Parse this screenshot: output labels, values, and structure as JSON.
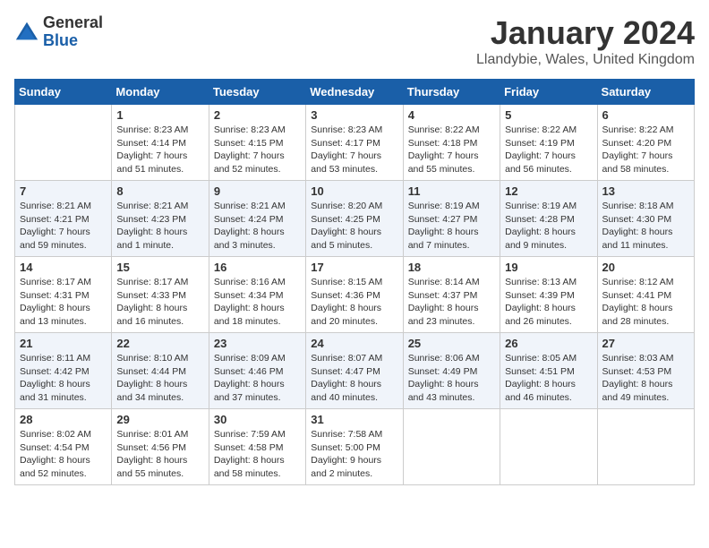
{
  "header": {
    "logo_line1": "General",
    "logo_line2": "Blue",
    "month_title": "January 2024",
    "location": "Llandybie, Wales, United Kingdom"
  },
  "weekdays": [
    "Sunday",
    "Monday",
    "Tuesday",
    "Wednesday",
    "Thursday",
    "Friday",
    "Saturday"
  ],
  "weeks": [
    [
      {
        "day": "",
        "sunrise": "",
        "sunset": "",
        "daylight": ""
      },
      {
        "day": "1",
        "sunrise": "Sunrise: 8:23 AM",
        "sunset": "Sunset: 4:14 PM",
        "daylight": "Daylight: 7 hours and 51 minutes."
      },
      {
        "day": "2",
        "sunrise": "Sunrise: 8:23 AM",
        "sunset": "Sunset: 4:15 PM",
        "daylight": "Daylight: 7 hours and 52 minutes."
      },
      {
        "day": "3",
        "sunrise": "Sunrise: 8:23 AM",
        "sunset": "Sunset: 4:17 PM",
        "daylight": "Daylight: 7 hours and 53 minutes."
      },
      {
        "day": "4",
        "sunrise": "Sunrise: 8:22 AM",
        "sunset": "Sunset: 4:18 PM",
        "daylight": "Daylight: 7 hours and 55 minutes."
      },
      {
        "day": "5",
        "sunrise": "Sunrise: 8:22 AM",
        "sunset": "Sunset: 4:19 PM",
        "daylight": "Daylight: 7 hours and 56 minutes."
      },
      {
        "day": "6",
        "sunrise": "Sunrise: 8:22 AM",
        "sunset": "Sunset: 4:20 PM",
        "daylight": "Daylight: 7 hours and 58 minutes."
      }
    ],
    [
      {
        "day": "7",
        "sunrise": "Sunrise: 8:21 AM",
        "sunset": "Sunset: 4:21 PM",
        "daylight": "Daylight: 7 hours and 59 minutes."
      },
      {
        "day": "8",
        "sunrise": "Sunrise: 8:21 AM",
        "sunset": "Sunset: 4:23 PM",
        "daylight": "Daylight: 8 hours and 1 minute."
      },
      {
        "day": "9",
        "sunrise": "Sunrise: 8:21 AM",
        "sunset": "Sunset: 4:24 PM",
        "daylight": "Daylight: 8 hours and 3 minutes."
      },
      {
        "day": "10",
        "sunrise": "Sunrise: 8:20 AM",
        "sunset": "Sunset: 4:25 PM",
        "daylight": "Daylight: 8 hours and 5 minutes."
      },
      {
        "day": "11",
        "sunrise": "Sunrise: 8:19 AM",
        "sunset": "Sunset: 4:27 PM",
        "daylight": "Daylight: 8 hours and 7 minutes."
      },
      {
        "day": "12",
        "sunrise": "Sunrise: 8:19 AM",
        "sunset": "Sunset: 4:28 PM",
        "daylight": "Daylight: 8 hours and 9 minutes."
      },
      {
        "day": "13",
        "sunrise": "Sunrise: 8:18 AM",
        "sunset": "Sunset: 4:30 PM",
        "daylight": "Daylight: 8 hours and 11 minutes."
      }
    ],
    [
      {
        "day": "14",
        "sunrise": "Sunrise: 8:17 AM",
        "sunset": "Sunset: 4:31 PM",
        "daylight": "Daylight: 8 hours and 13 minutes."
      },
      {
        "day": "15",
        "sunrise": "Sunrise: 8:17 AM",
        "sunset": "Sunset: 4:33 PM",
        "daylight": "Daylight: 8 hours and 16 minutes."
      },
      {
        "day": "16",
        "sunrise": "Sunrise: 8:16 AM",
        "sunset": "Sunset: 4:34 PM",
        "daylight": "Daylight: 8 hours and 18 minutes."
      },
      {
        "day": "17",
        "sunrise": "Sunrise: 8:15 AM",
        "sunset": "Sunset: 4:36 PM",
        "daylight": "Daylight: 8 hours and 20 minutes."
      },
      {
        "day": "18",
        "sunrise": "Sunrise: 8:14 AM",
        "sunset": "Sunset: 4:37 PM",
        "daylight": "Daylight: 8 hours and 23 minutes."
      },
      {
        "day": "19",
        "sunrise": "Sunrise: 8:13 AM",
        "sunset": "Sunset: 4:39 PM",
        "daylight": "Daylight: 8 hours and 26 minutes."
      },
      {
        "day": "20",
        "sunrise": "Sunrise: 8:12 AM",
        "sunset": "Sunset: 4:41 PM",
        "daylight": "Daylight: 8 hours and 28 minutes."
      }
    ],
    [
      {
        "day": "21",
        "sunrise": "Sunrise: 8:11 AM",
        "sunset": "Sunset: 4:42 PM",
        "daylight": "Daylight: 8 hours and 31 minutes."
      },
      {
        "day": "22",
        "sunrise": "Sunrise: 8:10 AM",
        "sunset": "Sunset: 4:44 PM",
        "daylight": "Daylight: 8 hours and 34 minutes."
      },
      {
        "day": "23",
        "sunrise": "Sunrise: 8:09 AM",
        "sunset": "Sunset: 4:46 PM",
        "daylight": "Daylight: 8 hours and 37 minutes."
      },
      {
        "day": "24",
        "sunrise": "Sunrise: 8:07 AM",
        "sunset": "Sunset: 4:47 PM",
        "daylight": "Daylight: 8 hours and 40 minutes."
      },
      {
        "day": "25",
        "sunrise": "Sunrise: 8:06 AM",
        "sunset": "Sunset: 4:49 PM",
        "daylight": "Daylight: 8 hours and 43 minutes."
      },
      {
        "day": "26",
        "sunrise": "Sunrise: 8:05 AM",
        "sunset": "Sunset: 4:51 PM",
        "daylight": "Daylight: 8 hours and 46 minutes."
      },
      {
        "day": "27",
        "sunrise": "Sunrise: 8:03 AM",
        "sunset": "Sunset: 4:53 PM",
        "daylight": "Daylight: 8 hours and 49 minutes."
      }
    ],
    [
      {
        "day": "28",
        "sunrise": "Sunrise: 8:02 AM",
        "sunset": "Sunset: 4:54 PM",
        "daylight": "Daylight: 8 hours and 52 minutes."
      },
      {
        "day": "29",
        "sunrise": "Sunrise: 8:01 AM",
        "sunset": "Sunset: 4:56 PM",
        "daylight": "Daylight: 8 hours and 55 minutes."
      },
      {
        "day": "30",
        "sunrise": "Sunrise: 7:59 AM",
        "sunset": "Sunset: 4:58 PM",
        "daylight": "Daylight: 8 hours and 58 minutes."
      },
      {
        "day": "31",
        "sunrise": "Sunrise: 7:58 AM",
        "sunset": "Sunset: 5:00 PM",
        "daylight": "Daylight: 9 hours and 2 minutes."
      },
      {
        "day": "",
        "sunrise": "",
        "sunset": "",
        "daylight": ""
      },
      {
        "day": "",
        "sunrise": "",
        "sunset": "",
        "daylight": ""
      },
      {
        "day": "",
        "sunrise": "",
        "sunset": "",
        "daylight": ""
      }
    ]
  ]
}
